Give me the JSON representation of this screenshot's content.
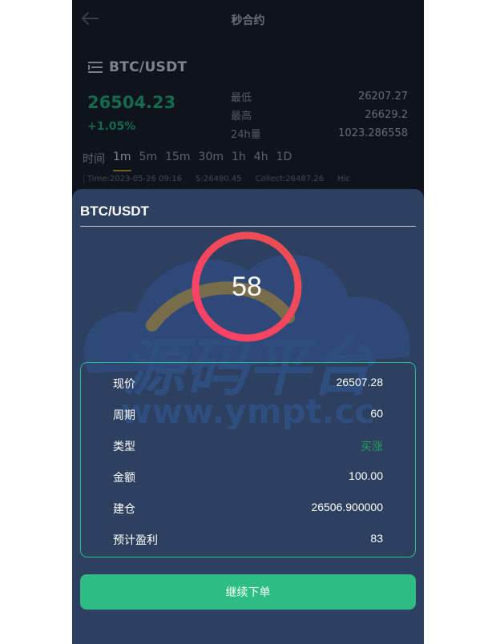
{
  "header": {
    "title": "秒合约",
    "back_icon": "arrow-left-icon"
  },
  "market": {
    "pair": "BTC/USDT",
    "menu_icon": "menu-lines-icon",
    "price": "26504.23",
    "change": "+1.05%",
    "stats": [
      {
        "label": "最低",
        "value": "26207.27"
      },
      {
        "label": "最高",
        "value": "26629.2"
      },
      {
        "label": "24h量",
        "value": "1023.286558"
      }
    ],
    "timeframes": [
      "时间",
      "1m",
      "5m",
      "15m",
      "30m",
      "1h",
      "4h",
      "1D"
    ],
    "active_timeframe": "1m",
    "kline_info": [
      "Time:2023-05-26 09:16",
      "S:26490.45",
      "Collect:26487.26",
      "Hic"
    ]
  },
  "modal": {
    "title": "BTC/USDT",
    "countdown": "58",
    "countdown_fraction": 1.0,
    "rows": [
      {
        "label": "现价",
        "value": "26507.28"
      },
      {
        "label": "周期",
        "value": "60"
      },
      {
        "label": "类型",
        "value": "买涨",
        "color": "#1fa15a"
      },
      {
        "label": "金额",
        "value": "100.00"
      },
      {
        "label": "建仓",
        "value": "26506.900000"
      },
      {
        "label": "预计盈利",
        "value": "83"
      }
    ],
    "continue_button": "继续下单"
  },
  "watermark": {
    "title": "源码平台",
    "url": "www.ympt.cc"
  },
  "colors": {
    "accent_green": "#2dbd83",
    "up_green": "#1fb07a",
    "timer_ring_start": "#ff3f6b",
    "timer_ring_end": "#e94f4f",
    "modal_bg": "#2d4060",
    "page_bg": "#151a26"
  }
}
